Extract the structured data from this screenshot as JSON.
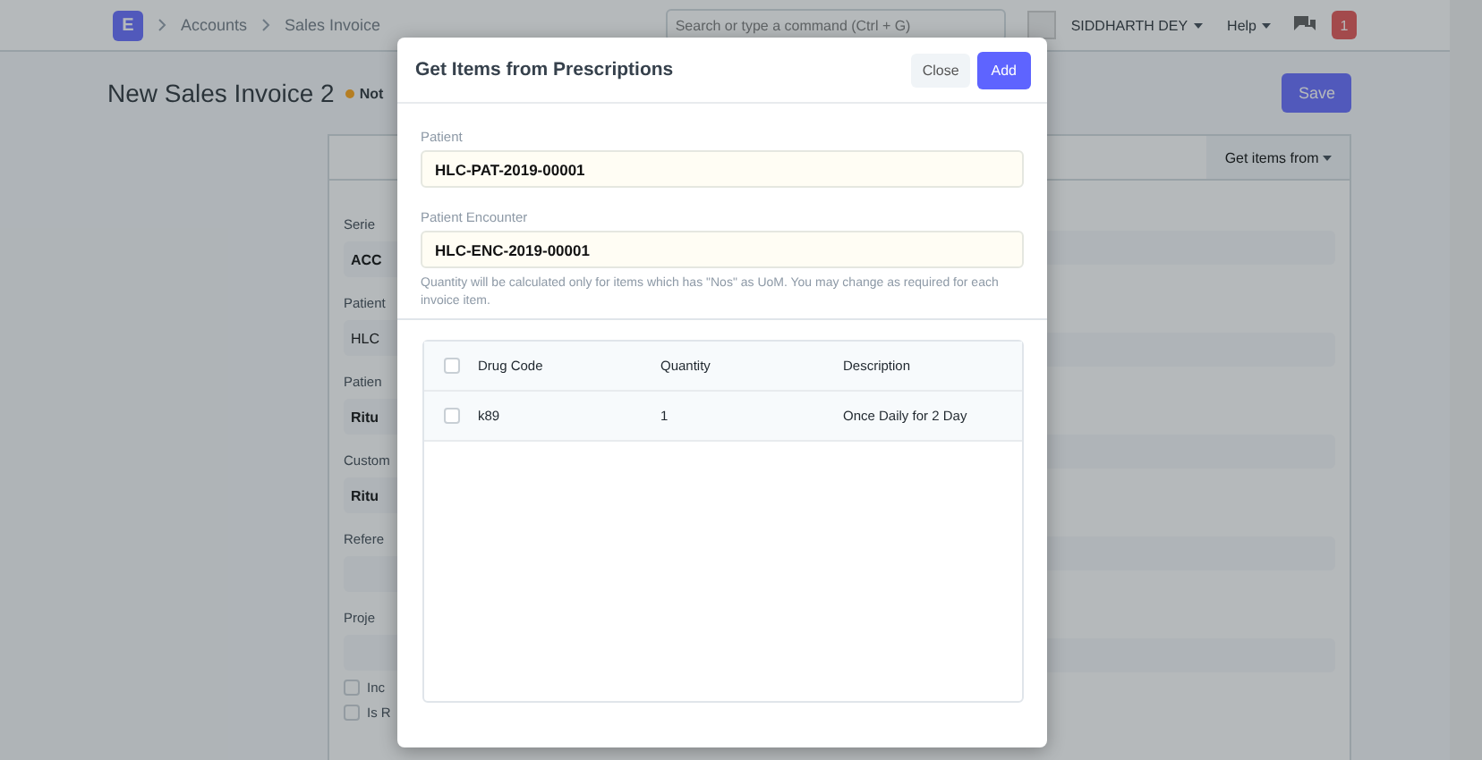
{
  "navbar": {
    "breadcrumbs": [
      "Accounts",
      "Sales Invoice"
    ],
    "logo": "E",
    "search": {
      "placeholder": "Search or type a command (Ctrl + G)"
    },
    "user": "SIDDHARTH DEY",
    "help": "Help",
    "notifications": "1"
  },
  "page": {
    "title": "New Sales Invoice 2",
    "status": "Not",
    "save": "Save",
    "get_items": "Get items from"
  },
  "form": {
    "fields": [
      {
        "label": "Serie",
        "value": "ACC",
        "kind": "select"
      },
      {
        "label": "Patient",
        "value": "HLC",
        "kind": "text"
      },
      {
        "label": "Patien",
        "value": "Ritu",
        "kind": "select"
      },
      {
        "label": "Custom",
        "value": "Ritu",
        "kind": "select"
      },
      {
        "label": "Refere",
        "kind": "text"
      },
      {
        "label": "Proje",
        "kind": "text"
      },
      {
        "label": "Inc",
        "kind": "check",
        "checked": false
      },
      {
        "label": "Is R",
        "kind": "check",
        "checked": false
      }
    ]
  },
  "dialog": {
    "title": "Get Items from Prescriptions",
    "close": "Close",
    "add": "Add",
    "fields": [
      {
        "label": "Patient",
        "value": "HLC-PAT-2019-00001"
      },
      {
        "label": "Patient Encounter",
        "value": "HLC-ENC-2019-00001"
      }
    ],
    "help": "Quantity will be calculated only for items which has \"Nos\" as UoM. You may change as required for each invoice item.",
    "table": {
      "columns": [
        "Drug Code",
        "Quantity",
        "Description"
      ],
      "all_checked": false,
      "rows": [
        {
          "cells": [
            "k89",
            "1",
            "Once Daily for 2 Day"
          ],
          "checked": false
        }
      ]
    }
  }
}
